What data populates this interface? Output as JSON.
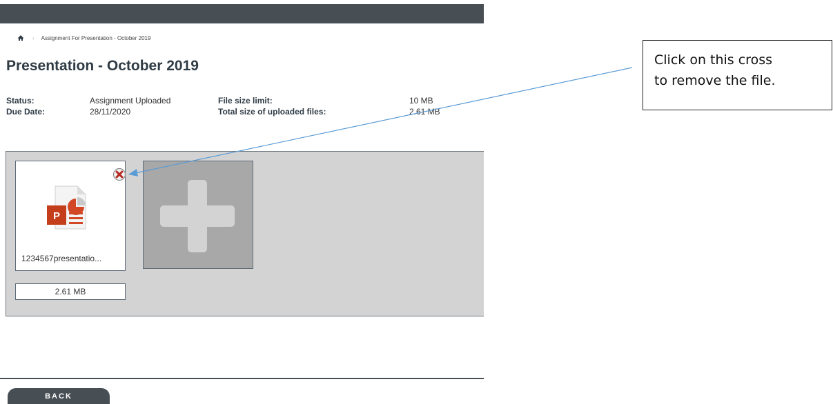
{
  "breadcrumb": {
    "home_icon": "home-icon",
    "current": "Assignment For Presentation - October 2019"
  },
  "page": {
    "title": "Presentation - October 2019"
  },
  "info": {
    "status_label": "Status:",
    "status_value": "Assignment Uploaded",
    "due_label": "Due Date:",
    "due_value": "28/11/2020",
    "limit_label": "File size limit:",
    "limit_value": "10 MB",
    "total_label": "Total size of uploaded files:",
    "total_value": "2.61 MB"
  },
  "files": [
    {
      "name": "1234567presentatio...",
      "size": "2.61 MB",
      "icon": "powerpoint-file-icon",
      "remove_icon": "remove-file-icon"
    }
  ],
  "add_tile": {
    "icon": "plus-icon"
  },
  "back_button": {
    "label": "BACK"
  },
  "callout": {
    "line1": "Click on this cross",
    "line2": "to remove the file."
  },
  "colors": {
    "topbar": "#474e54",
    "title": "#2f3b45",
    "panel": "#d3d3d3",
    "add_tile": "#a8a8a8",
    "arrow": "#5b9bd5",
    "ppt_orange": "#d24726"
  }
}
